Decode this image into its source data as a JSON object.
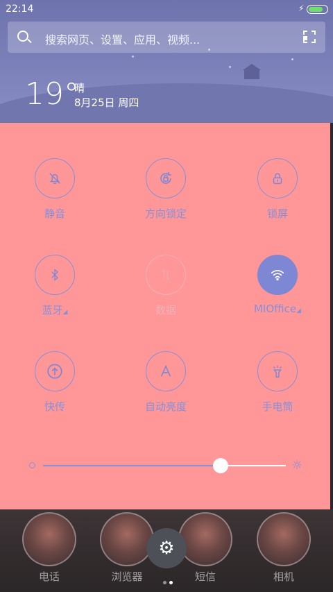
{
  "status_bar": {
    "time": "22:14",
    "battery_level": 0.85,
    "charging_icon": "bolt-icon"
  },
  "search": {
    "placeholder": "搜索网页、设置、应用、视频...",
    "search_icon": "search-icon",
    "scan_icon": "scan-icon"
  },
  "weather": {
    "temperature": "19°",
    "condition": "晴",
    "date": "8月25日 周四"
  },
  "colors": {
    "header": "#7378b0",
    "panel": "#ff9697",
    "accent": "#8590d8"
  },
  "toggles": [
    {
      "label": "静音",
      "icon": "bell-off-icon",
      "state": "off"
    },
    {
      "label": "方向锁定",
      "icon": "rotation-lock-icon",
      "state": "off"
    },
    {
      "label": "锁屏",
      "icon": "lock-icon",
      "state": "off"
    },
    {
      "label": "蓝牙",
      "icon": "bluetooth-icon",
      "state": "off",
      "has_menu": true
    },
    {
      "label": "数据",
      "icon": "mobile-data-icon",
      "state": "disabled"
    },
    {
      "label": "MIOffice",
      "icon": "wifi-icon",
      "state": "on",
      "has_menu": true
    },
    {
      "label": "快传",
      "icon": "upload-circle-icon",
      "state": "off"
    },
    {
      "label": "自动亮度",
      "icon": "auto-brightness-icon",
      "state": "off"
    },
    {
      "label": "手电筒",
      "icon": "flashlight-icon",
      "state": "off"
    }
  ],
  "brightness": {
    "level": 0.73,
    "min_icon": "brightness-low-icon",
    "max_icon": "brightness-high-icon"
  },
  "dock": {
    "apps": [
      {
        "label": "电话"
      },
      {
        "label": "浏览器"
      },
      {
        "label": "短信"
      },
      {
        "label": "相机"
      }
    ],
    "settings_icon": "gear-icon",
    "page_count": 2,
    "current_page": 2
  }
}
